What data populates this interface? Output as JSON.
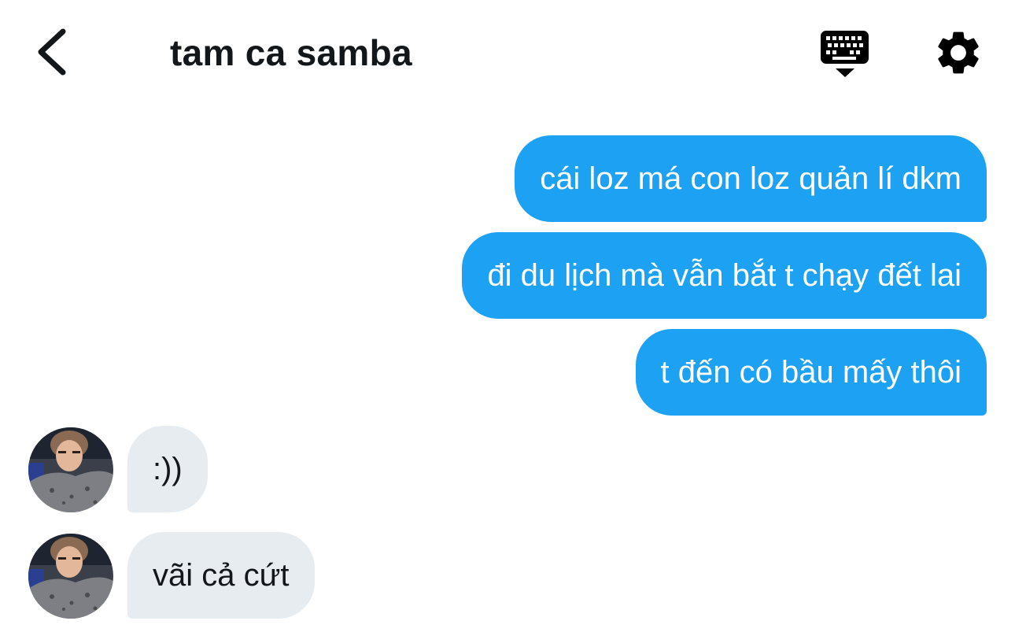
{
  "header": {
    "title": "tam ca samba",
    "back_icon": "chevron-left-icon",
    "keyboard_icon": "keyboard-dismiss-icon",
    "settings_icon": "gear-icon"
  },
  "colors": {
    "sent_bubble": "#1da1f2",
    "received_bubble": "#e6ecf0",
    "text_dark": "#14171a",
    "text_light": "#ffffff"
  },
  "messages": [
    {
      "direction": "sent",
      "text": "cái loz má con loz quản lí dkm"
    },
    {
      "direction": "sent",
      "text": "đi du lịch mà vẫn bắt t chạy đết lai"
    },
    {
      "direction": "sent",
      "text": "t đến có bầu mấy thôi"
    },
    {
      "direction": "received",
      "text": ":))"
    },
    {
      "direction": "received",
      "text": "vãi cả cứt"
    }
  ]
}
